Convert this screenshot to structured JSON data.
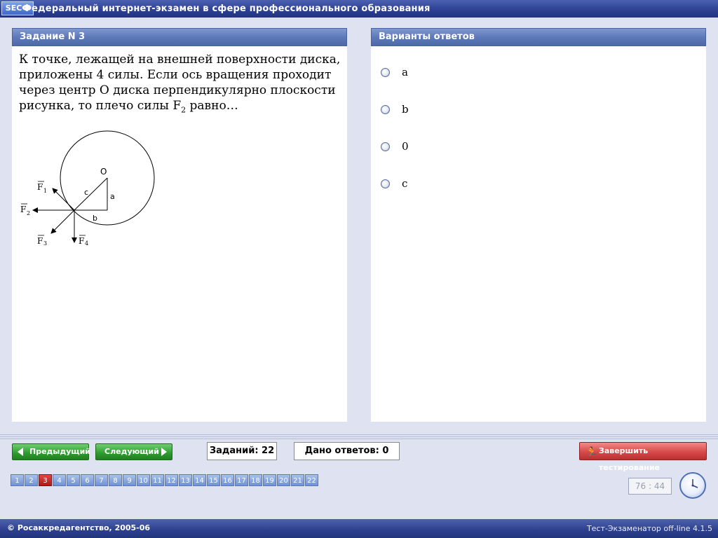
{
  "app": {
    "logo_text": "SECФ",
    "title": "Федеральный интернет-экзамен в сфере профессионального образования"
  },
  "question": {
    "header": "Задание N 3",
    "text_main": "К точке, лежащей на внешней поверхности диска, приложены 4 силы. Если ось вращения проходит через центр O диска перпендикулярно плоскости рисунка, то плечо силы F",
    "text_sub": "2",
    "text_end": " равно…",
    "figure_labels": {
      "center": "O",
      "c": "c",
      "a": "a",
      "b": "b",
      "f1": "F",
      "f1_sub": "1",
      "f2": "F",
      "f2_sub": "2",
      "f3": "F",
      "f3_sub": "3",
      "f4": "F",
      "f4_sub": "4"
    }
  },
  "answers": {
    "header": "Варианты ответов",
    "options": [
      {
        "label": "a"
      },
      {
        "label": "b"
      },
      {
        "label": "0"
      },
      {
        "label": "c"
      }
    ]
  },
  "nav": {
    "prev_label": "Предыдущий",
    "next_label": "Следующий",
    "total_tasks": "Заданий: 22",
    "answered": "Дано ответов: 0",
    "finish_label": "Завершить тестирование",
    "pages": [
      "1",
      "2",
      "3",
      "4",
      "5",
      "6",
      "7",
      "8",
      "9",
      "10",
      "11",
      "12",
      "13",
      "14",
      "15",
      "16",
      "17",
      "18",
      "19",
      "20",
      "21",
      "22"
    ],
    "current_page": "3",
    "timer": "76 : 44"
  },
  "footer": {
    "copyright": "© Росаккредагентство, 2005-06",
    "version": "Тест-Экзаменатор off-line 4.1.5"
  },
  "colors": {
    "header_blue": "#2c3f92",
    "panel_head": "#5e79b9",
    "next_green": "#2f9a2f",
    "finish_red": "#d84a4a",
    "current_page_red": "#b01818"
  }
}
